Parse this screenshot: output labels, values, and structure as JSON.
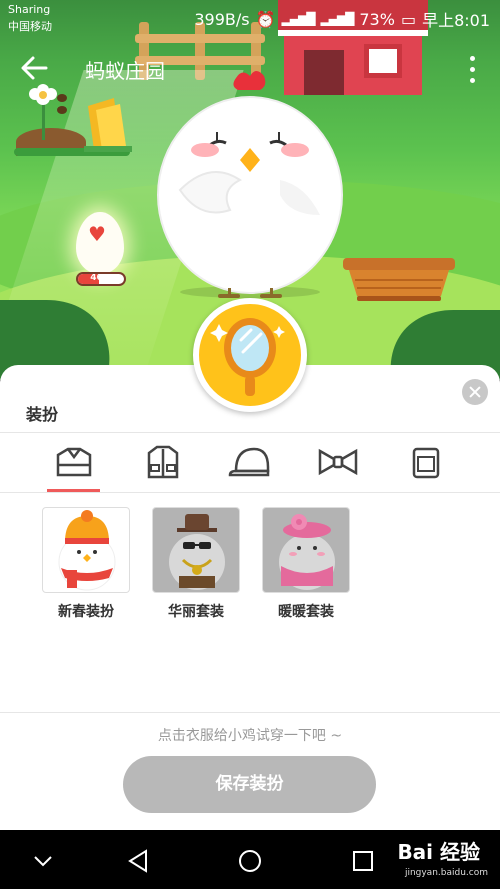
{
  "status_bar": {
    "carrier_top": "Sharing",
    "carrier_bottom": "中国移动",
    "net_speed": "399B/s",
    "battery": "73%",
    "time": "早上8:01"
  },
  "app_bar": {
    "title": "蚂蚁庄园"
  },
  "egg": {
    "progress_text": "46%",
    "progress": 0.46
  },
  "sheet": {
    "title": "装扮",
    "categories": [
      {
        "icon": "clothes-set-icon",
        "selected": true
      },
      {
        "icon": "jacket-icon",
        "selected": false
      },
      {
        "icon": "cap-icon",
        "selected": false
      },
      {
        "icon": "bowtie-icon",
        "selected": false
      },
      {
        "icon": "bag-icon",
        "selected": false
      }
    ],
    "outfits": [
      {
        "label": "新春装扮"
      },
      {
        "label": "华丽套装"
      },
      {
        "label": "暖暖套装"
      }
    ],
    "hint": "点击衣服给小鸡试穿一下吧 ~",
    "save_label": "保存装扮"
  },
  "watermark": {
    "text": "Bai 经验",
    "sub": "jingyan.baidu.com"
  },
  "colors": {
    "accent_underline": "#ef5a5a",
    "mirror_bg": "#ffc21a",
    "save_disabled": "#b8b8b8"
  }
}
